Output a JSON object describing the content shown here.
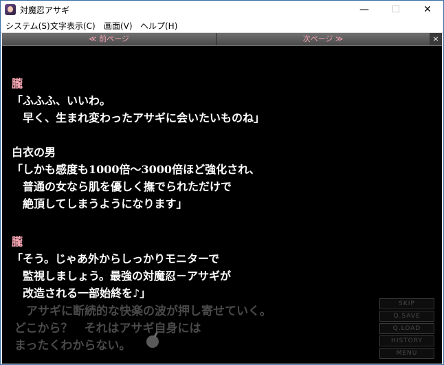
{
  "window": {
    "title": "対魔忍アサギ",
    "min_glyph": "—",
    "max_glyph": "☐",
    "close_glyph": "✕"
  },
  "menubar": {
    "items": [
      "システム(S)",
      "文字表示(C)",
      "画面(V)",
      "ヘルプ(H)"
    ]
  },
  "backlog_nav": {
    "prev_label": "≪ 前ページ",
    "next_label": "次ページ ≫",
    "close_label": "×"
  },
  "backlog": {
    "lines": [
      {
        "text": "朧",
        "role": "speaker"
      },
      {
        "text": "「ふふふ、いいわ。",
        "role": "dialogue"
      },
      {
        "text": "　早く、生まれ変わったアサギに会いたいものね」",
        "role": "dialogue"
      },
      {
        "text": "白衣の男",
        "role": "speaker"
      },
      {
        "text": "「しかも感度も1000倍～3000倍ほど強化され、",
        "role": "dialogue"
      },
      {
        "text": "　普通の女なら肌を優しく撫でられただけで",
        "role": "dialogue"
      },
      {
        "text": "　絶頂してしまうようになります」",
        "role": "dialogue"
      },
      {
        "text": "朧",
        "role": "speaker"
      },
      {
        "text": "「そう。じゃあ外からしっかりモニターで",
        "role": "dialogue"
      },
      {
        "text": "　監視しましょう。最強の対魔忍－アサギが",
        "role": "dialogue"
      },
      {
        "text": "　改造される一部始終を♪」",
        "role": "dialogue"
      }
    ]
  },
  "current_text": {
    "lines": [
      "　アサギに断続的な快楽の波が押し寄せていく。",
      "どこから？　それはアサギ自身には",
      "まったくわからない。"
    ]
  },
  "system_menu": {
    "items": [
      "SKIP",
      "Q.SAVE",
      "Q.LOAD",
      "HISTORY",
      "MENU"
    ]
  },
  "colors": {
    "speaker": "#f6a5b2",
    "dialogue": "#ffffff",
    "nav_text": "#f2a0b0"
  }
}
